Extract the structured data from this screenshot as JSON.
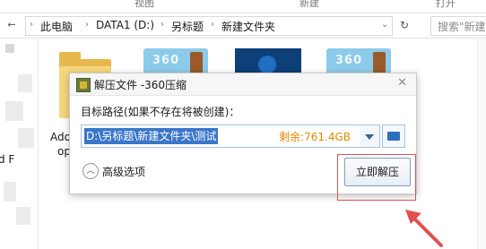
{
  "ribbon": {
    "partial_labels": [
      "视图",
      "新建",
      "打开"
    ]
  },
  "address_bar": {
    "back_icon": "back-arrow-icon",
    "breadcrumb": [
      "此电脑",
      "DATA1 (D:)",
      "另标题",
      "新建文件夹"
    ],
    "refresh_icon": "refresh-icon",
    "dropdown_icon": "chevron-down-icon",
    "search_placeholder": "搜索\"新建"
  },
  "files": [
    {
      "label_line1": "Ado",
      "label_line2": "op",
      "type": "folder"
    },
    {
      "label": "",
      "type": "360-archive",
      "overlay_text": "360"
    },
    {
      "label": "",
      "type": "image"
    },
    {
      "label": "",
      "type": "360-archive",
      "overlay_text": "360"
    }
  ],
  "left_pane_fragment": "d F",
  "dialog": {
    "title": "解压文件 -360压缩",
    "close_icon": "close-icon",
    "path_label": "目标路径(如果不存在将被创建)：",
    "path_value": "D:\\另标题\\新建文件夹\\测试",
    "free_space": "剩余:761.4GB",
    "advanced_label": "高级选项",
    "extract_button": "立即解压"
  },
  "annotation": {
    "color": "#e35050",
    "highlight": "red rectangle around the extract button",
    "arrow": "red arrow pointing at the extract button"
  }
}
